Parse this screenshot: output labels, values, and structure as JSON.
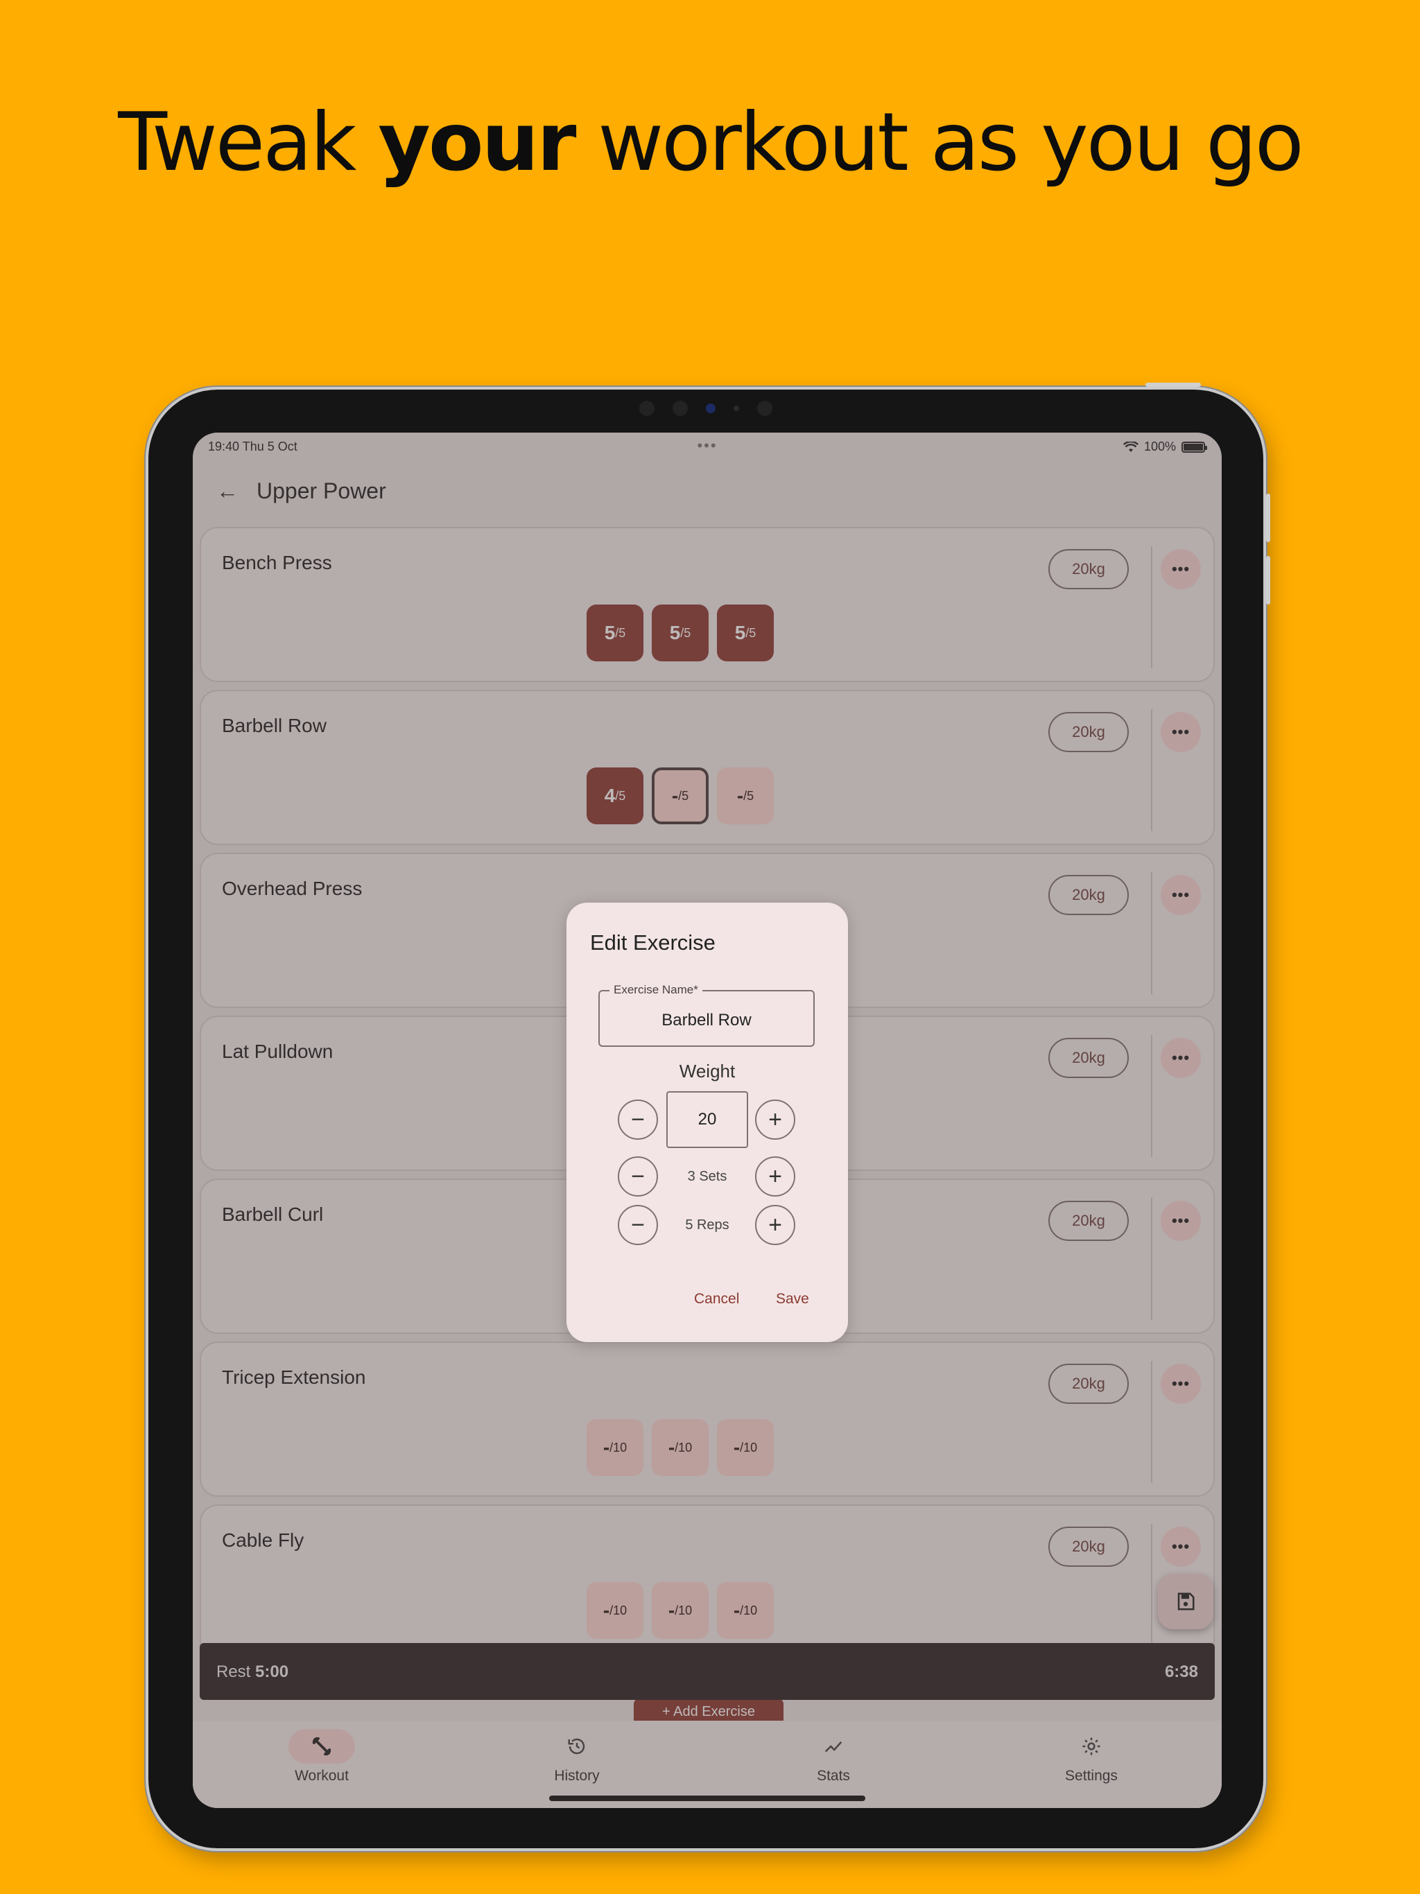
{
  "headline": {
    "pre": "Tweak ",
    "bold": "your",
    "post": " workout as you go"
  },
  "status": {
    "time": "19:40  Thu 5 Oct",
    "dots": "•••",
    "battery": "100%"
  },
  "appbar": {
    "title": "Upper Power"
  },
  "exercises": [
    {
      "name": "Bench Press",
      "weight": "20kg",
      "sets": [
        {
          "reps": "5",
          "target": "/5",
          "state": "done"
        },
        {
          "reps": "5",
          "target": "/5",
          "state": "done"
        },
        {
          "reps": "5",
          "target": "/5",
          "state": "done"
        }
      ]
    },
    {
      "name": "Barbell Row",
      "weight": "20kg",
      "sets": [
        {
          "reps": "4",
          "target": "/5",
          "state": "done"
        },
        {
          "reps": "-",
          "target": "/5",
          "state": "active"
        },
        {
          "reps": "-",
          "target": "/5",
          "state": "pending"
        }
      ]
    },
    {
      "name": "Overhead Press",
      "weight": "20kg",
      "sets": []
    },
    {
      "name": "Lat Pulldown",
      "weight": "20kg",
      "sets": []
    },
    {
      "name": "Barbell Curl",
      "weight": "20kg",
      "sets": []
    },
    {
      "name": "Tricep Extension",
      "weight": "20kg",
      "sets": [
        {
          "reps": "-",
          "target": "/10",
          "state": "pending"
        },
        {
          "reps": "-",
          "target": "/10",
          "state": "pending"
        },
        {
          "reps": "-",
          "target": "/10",
          "state": "pending"
        }
      ]
    },
    {
      "name": "Cable Fly",
      "weight": "20kg",
      "sets": [
        {
          "reps": "-",
          "target": "/10",
          "state": "pending"
        },
        {
          "reps": "-",
          "target": "/10",
          "state": "pending"
        },
        {
          "reps": "-",
          "target": "/10",
          "state": "pending"
        }
      ]
    }
  ],
  "more_label": "•••",
  "rest": {
    "label": "Rest ",
    "time": "5:00",
    "elapsed": "6:38"
  },
  "add_exercise": "+ Add Exercise",
  "nav": [
    {
      "label": "Workout",
      "icon": "dumbbell-icon",
      "active": true
    },
    {
      "label": "History",
      "icon": "history-icon",
      "active": false
    },
    {
      "label": "Stats",
      "icon": "trend-icon",
      "active": false
    },
    {
      "label": "Settings",
      "icon": "gear-icon",
      "active": false
    }
  ],
  "dialog": {
    "title": "Edit Exercise",
    "name_label": "Exercise Name*",
    "name_value": "Barbell Row",
    "weight_label": "Weight",
    "weight_value": "20",
    "sets_text": "3 Sets",
    "reps_text": "5 Reps",
    "minus": "−",
    "plus": "+",
    "cancel": "Cancel",
    "save": "Save"
  },
  "colors": {
    "background": "#FFAD00",
    "accent": "#8C3A32",
    "set_pending": "#FBD5D0"
  }
}
